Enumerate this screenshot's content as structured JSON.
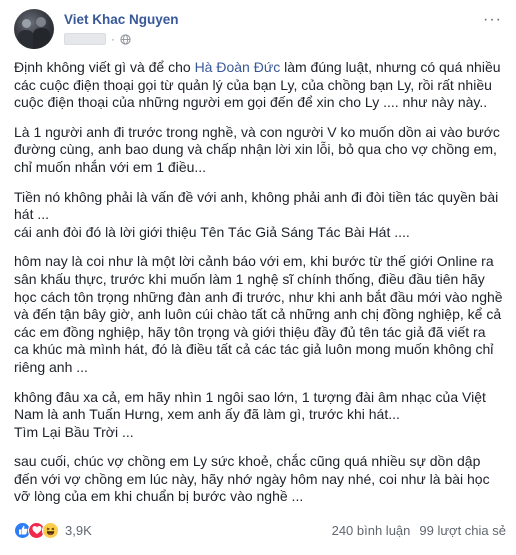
{
  "post": {
    "author": "Viet Khac Nguyen",
    "separator": "·",
    "privacy_icon": "globe-icon",
    "more_icon": "more-horizontal-icon",
    "more_label": "···"
  },
  "content": {
    "p1_before": "Định không viết gì và để cho ",
    "p1_mention": "Hà Đoàn Đức",
    "p1_after": " làm đúng luật, nhưng có quá nhiều\ncác cuộc điện thoại gọi từ quản lý của bạn Ly, của chồng bạn Ly, rồi rất nhiều\ncuộc điện thoại của những người em gọi đến để xin cho Ly .... như này này..",
    "p2": "Là 1 người anh đi trước trong nghề, và con người V ko muốn dồn ai vào bước\nđường cùng, anh bao dung và chấp nhận lời xin lỗi, bỏ qua cho vợ chồng em,\nchỉ muốn nhắn với em 1 điều...",
    "p3": "Tiền nó không phải là vấn đề với anh, không phải anh đi đòi tiền tác quyền bài\nhát ...",
    "p4": "cái anh đòi đó là lời giới thiệu Tên Tác Giả Sáng Tác Bài Hát ....",
    "p5": "hôm nay là coi như là một lời cảnh báo với em, khi bước từ thế giới Online ra\nsân khấu thực, trước khi muốn làm 1 nghệ sĩ chính thống, điều đầu tiên hãy\nhọc cách tôn trọng những đàn anh đi trước, như khi anh bắt đầu mới vào nghề\nvà đến tận bây giờ, anh luôn cúi chào tất cả những anh chị đồng nghiệp, kể cả\ncác em đồng nghiệp, hãy tôn trọng và giới thiệu đầy đủ tên tác giả đã viết ra\nca khúc mà mình hát, đó là điều tất cả các tác giả luôn mong muốn không chỉ\nriêng anh ...",
    "p6": "không đâu xa cả, em hãy nhìn 1 ngôi sao lớn, 1 tượng đài âm nhạc của Việt\nNam là anh Tuấn Hưng, xem anh ấy đã làm gì, trước khi hát...",
    "p7": "Tìm Lại Bầu Trời ...",
    "p8": "sau cuối, chúc vợ chồng em Ly sức khoẻ, chắc cũng quá nhiều sự dồn dập\nđến với vợ chồng em lúc này, hãy nhớ ngày hôm nay nhé, coi như là bài học\nvỡ lòng của em khi chuẩn bị bước vào nghề ..."
  },
  "footer": {
    "reaction_icons": [
      "like-icon",
      "love-icon",
      "haha-icon"
    ],
    "reaction_count": "3,9K",
    "comments": "240 bình luận",
    "shares": "99 lượt chia sẻ"
  },
  "colors": {
    "link": "#385898",
    "text": "#1d2129",
    "muted": "#606770",
    "like": "#2e7cf6",
    "love": "#f0284a",
    "haha": "#fbcd4a"
  }
}
